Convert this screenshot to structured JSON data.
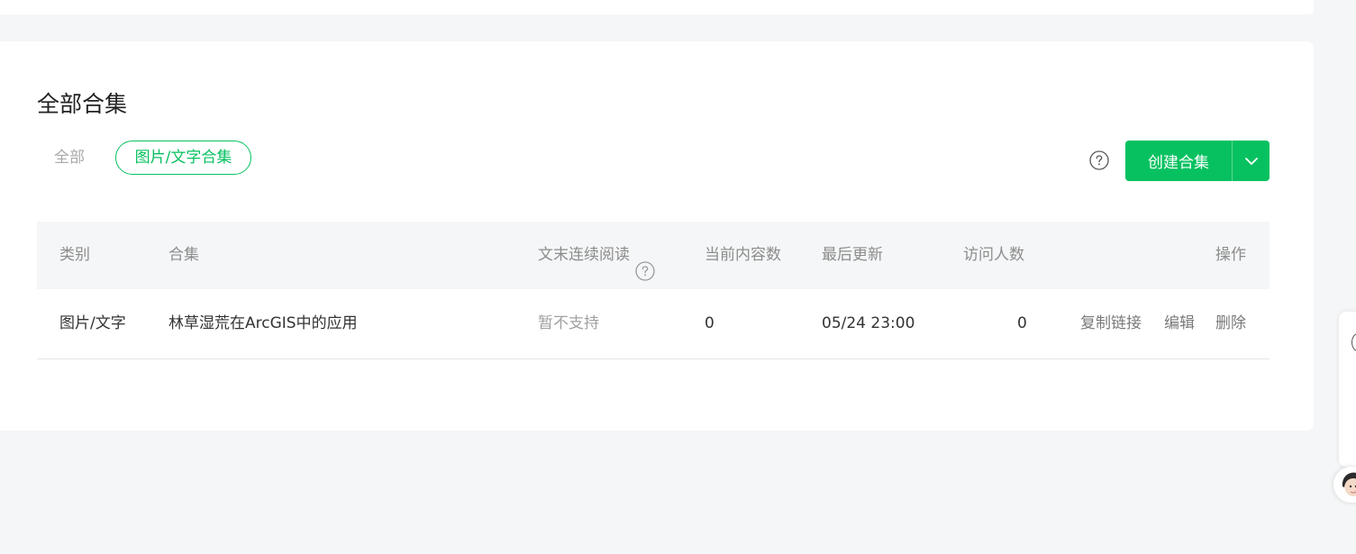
{
  "section": {
    "title": "全部合集"
  },
  "filters": {
    "all": "全部",
    "active": "图片/文字合集"
  },
  "toolbar": {
    "help_icon": "question-circle-icon",
    "create_label": "创建合集",
    "caret_icon": "chevron-down-icon"
  },
  "table": {
    "headers": {
      "category": "类别",
      "collection": "合集",
      "continuous": "文末连续阅读",
      "count": "当前内容数",
      "updated": "最后更新",
      "visitors": "访问人数",
      "actions": "操作"
    },
    "rows": [
      {
        "category": "图片/文字",
        "collection": "林草湿荒在ArcGIS中的应用",
        "continuous": "暂不支持",
        "count": "0",
        "updated": "05/24 23:00",
        "visitors": "0",
        "copy_link": "复制链接",
        "edit": "编辑",
        "delete": "删除"
      }
    ]
  },
  "colors": {
    "accent": "#07c160",
    "page_bg": "#f5f6f7"
  }
}
